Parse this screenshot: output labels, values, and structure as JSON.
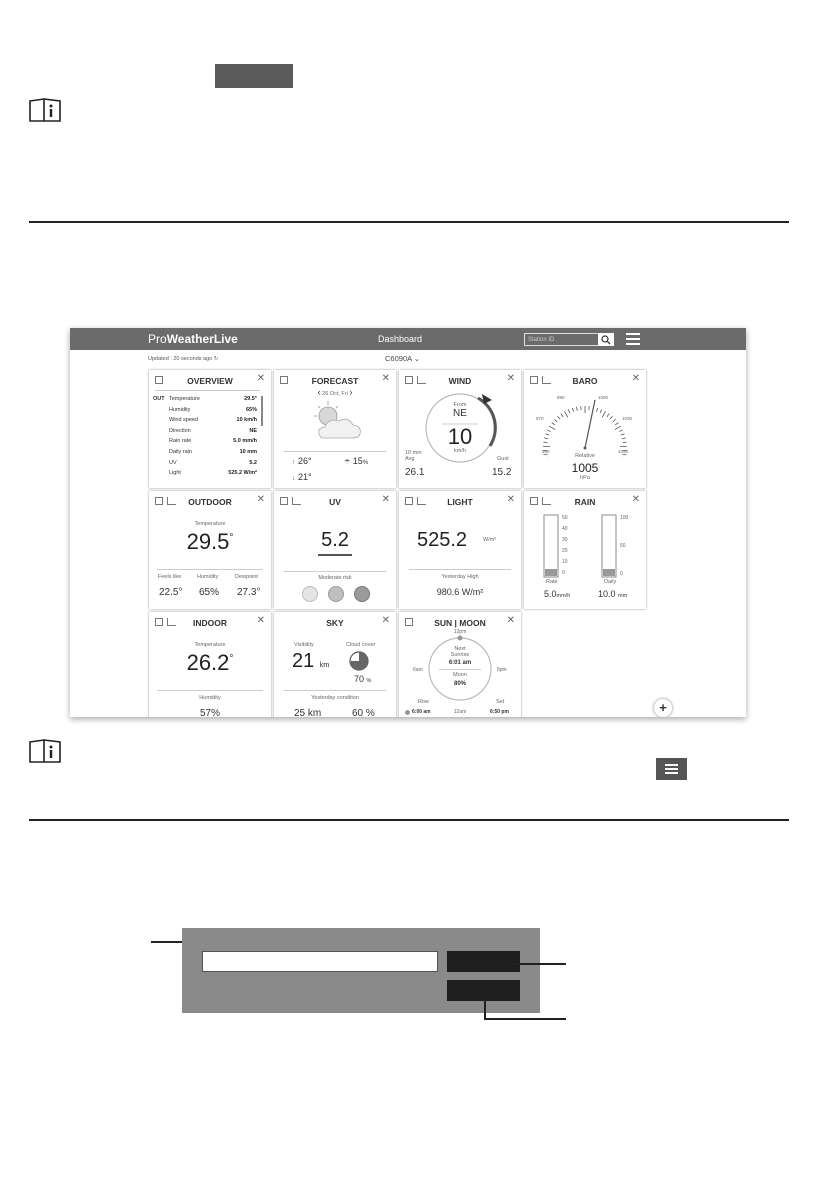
{
  "dashboard": {
    "logo_pro": "Pro",
    "logo_rest": "WeatherLive",
    "title": "Dashboard",
    "station_placeholder": "Station ID",
    "updated": "Updated : 20 seconds ago",
    "station_name": "C6090A",
    "overview": {
      "title": "OVERVIEW",
      "prefix": "OUT",
      "rows": [
        {
          "label": "Temperature",
          "value": "29.5°"
        },
        {
          "label": "Humidity",
          "value": "65%"
        },
        {
          "label": "Wind speed",
          "value": "10 km/h"
        },
        {
          "label": "Direction",
          "value": "NE"
        },
        {
          "label": "Rain rate",
          "value": "5.0 mm/h"
        },
        {
          "label": "Daily rain",
          "value": "10 mm"
        },
        {
          "label": "UV",
          "value": "5.2"
        },
        {
          "label": "Light",
          "value": "525.2 W/m²"
        }
      ]
    },
    "forecast": {
      "title": "FORECAST",
      "date": "26 Oct, Fri",
      "hi": "26°",
      "lo": "21°",
      "rain": "15",
      "rain_unit": "%"
    },
    "wind": {
      "title": "WIND",
      "from_label": "From",
      "direction": "NE",
      "speed": "10",
      "unit": "km/h",
      "avg_label": "10 min\nAvg",
      "avg": "26.1",
      "gust_label": "Gust",
      "gust": "15.2"
    },
    "baro": {
      "title": "BARO",
      "ticks": [
        "950",
        "970",
        "990",
        "1000",
        "1030",
        "1050"
      ],
      "label": "Relative",
      "value": "1005",
      "unit": "hPa"
    },
    "outdoor": {
      "title": "OUTDOOR",
      "temp_label": "Temperature",
      "temp": "29.5",
      "deg": "°",
      "feels_label": "Feels like",
      "feels": "22.5°",
      "hum_label": "Humidity",
      "hum": "65%",
      "dew_label": "Dewpoint",
      "dew": "27.3°"
    },
    "uv": {
      "title": "UV",
      "value": "5.2",
      "risk": "Moderate risk"
    },
    "light": {
      "title": "LIGHT",
      "value": "525.2",
      "unit": "W/m²",
      "yest_label": "Yesterday High",
      "yest": "980.6 W/m²"
    },
    "rain": {
      "title": "RAIN",
      "rate_ticks": [
        "50",
        "40",
        "30",
        "20",
        "10",
        "0"
      ],
      "daily_ticks": [
        "100",
        "50",
        "0"
      ],
      "rate_label": "Rate",
      "daily_label": "Daily",
      "rate": "5.0",
      "rate_unit": "mm/h",
      "daily": "10.0",
      "daily_unit": "mm"
    },
    "indoor": {
      "title": "INDOOR",
      "temp_label": "Temperature",
      "temp": "26.2",
      "deg": "°",
      "hum_label": "Humidity",
      "hum": "57%"
    },
    "sky": {
      "title": "SKY",
      "vis_label": "Visibility",
      "vis": "21",
      "vis_unit": "km",
      "cloud_label": "Cloud cover",
      "cloud": "70",
      "cloud_unit": "%",
      "yest_label": "Yesterday condition",
      "yest_vis": "25 km",
      "yest_cloud": "60 %"
    },
    "sunmoon": {
      "title": "SUN | MOON",
      "noon": "12pm",
      "next_label": "Next\nSunrise",
      "next_time": "6:01 am",
      "moon_label": "Moon",
      "moon_pct": "80%",
      "left": "6am",
      "right": "6pm",
      "midnight": "12am",
      "rise_label": "Rise",
      "rise": "6:00 am",
      "set_label": "Set",
      "set": "6:50 pm"
    },
    "add": "+"
  }
}
